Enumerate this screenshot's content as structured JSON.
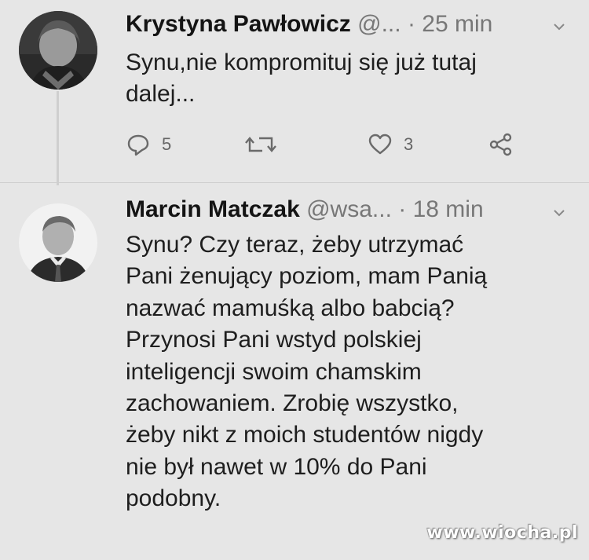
{
  "tweet1": {
    "name": "Krystyna Pawłowicz",
    "handle": "@...",
    "separator": "·",
    "time": "25 min",
    "text": "Synu,nie kompromituj się już tutaj\ndalej...",
    "actions": {
      "reply_count": "5",
      "retweet_count": "",
      "like_count": "3"
    },
    "avatar_icon": "user-avatar",
    "menu_icon": "chevron-down-icon"
  },
  "tweet2": {
    "name": "Marcin Matczak",
    "handle": "@wsa...",
    "separator": "·",
    "time": "18 min",
    "text": "Synu? Czy teraz, żeby utrzymać\nPani żenujący poziom, mam Panią\nnazwać mamuśką albo babcią?\nPrzynosi Pani wstyd polskiej\ninteligencji swoim chamskim\nzachowaniem. Zrobię wszystko,\nżeby nikt z moich studentów nigdy\nnie był nawet w 10% do Pani\npodobny.",
    "avatar_icon": "user-avatar",
    "menu_icon": "chevron-down-icon"
  },
  "watermark": "www.wiocha.pl",
  "colors": {
    "background": "#e6e6e6",
    "name": "#141414",
    "meta": "#777777",
    "icon": "#6a6a6a"
  }
}
